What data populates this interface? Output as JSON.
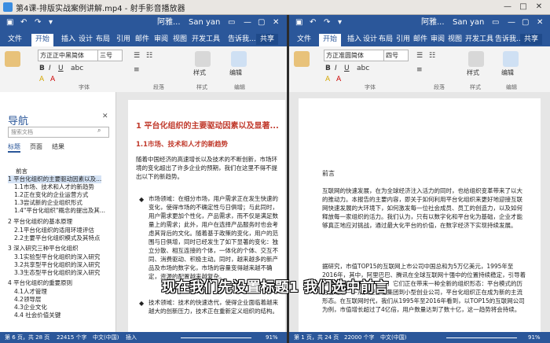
{
  "player": {
    "title": "第4课-排版实战案例讲解.mp4 - 射手影音播放器",
    "min_icon": "—",
    "max_icon": "□",
    "close_icon": "✕"
  },
  "left": {
    "qat_title": "阿雅...",
    "user": "San yan",
    "tabs": [
      "文件",
      "开始",
      "插入",
      "设计",
      "布局",
      "引用",
      "邮件",
      "审阅",
      "视图",
      "开发工具"
    ],
    "tell_me": "告诉我...",
    "share": "共享",
    "font_name": "方正正中黑简体",
    "font_size": "三号",
    "group_font": "字体",
    "group_para": "段落",
    "group_style": "样式",
    "group_edit": "编辑",
    "btn_style": "样式",
    "btn_edit": "编辑",
    "nav": {
      "title": "导航",
      "search_placeholder": "搜索文档",
      "tabs": [
        "标题",
        "页面",
        "结果"
      ],
      "items": [
        "前言",
        "1 平台化组织的主要驱动因素以及...",
        "1.1市场、技术和人才的新趋势",
        "1.2正在变化的企业运营方式",
        "1.3尝试新的企业组织形式",
        "1.4\"平台化组织\"概念的提出及其...",
        "2 平台化组织的基本原理",
        "2.1平台化组织的适用环境评估",
        "2.2主要平台化组织模式及其特点",
        "3 深入研究三种平台化组织",
        "3.1实验型平台化组织的深入研究",
        "3.2共享型平台化组织的深入研究",
        "3.3生态型平台化组织的深入研究",
        "4 平台化组织的重要原则",
        "4.1人才管理",
        "4.2领导层",
        "4.3企业文化",
        "4.4 社会价值关键"
      ]
    },
    "doc": {
      "h1": "1 平台化组织的主要驱动因素以及显著...",
      "h2": "1.1市场、技术和人才的新趋势",
      "intro": "随着中国经济的高速增长以及技术的不断创新，市场环境的变化超出了许多企业的预期，我们在这里不得不提出以下的新趋势。",
      "bullet1": "市场领域：在细分市场，用户需求正在发生快速的变化，使得市场的不确定性与日俱增；与此同时，用户需求更加个性化，产品需求，而不仅是满足数量上的需求；此外，用户在选择产品服务时也会考虑其背后的文化。随着基于政策的变化，用户的范围与日俱增，同时已经发生了如下显著的变化：独立分散、相互连接的个体，一体化的个体、交互不同、消费驱动、积极主动。同时，越来越多的新产品及市场的数字化，市场的容量变得越来越不确定，资源的配置越来越复杂。",
      "bullet2": "技术领域：技术的快速迭代，使得企业面临着越来越大的创新压力，技术正在重新定义组织的结构。",
      "page_status": "第 6 页，共 28 页",
      "words": "22415 个字",
      "lang": "中文(中国)",
      "mode": "插入",
      "zoom": "91%"
    }
  },
  "right": {
    "qat_title": "阿雅...",
    "user": "San yan",
    "tabs": [
      "文件",
      "开始",
      "插入",
      "设计",
      "布局",
      "引用",
      "邮件",
      "审阅",
      "视图",
      "开发工具"
    ],
    "tell_me": "告诉我...",
    "share": "共享",
    "font_name": "方正准圆简体",
    "font_size": "四号",
    "group_font": "字体",
    "group_para": "段落",
    "group_style": "样式",
    "group_edit": "编辑",
    "btn_style": "样式",
    "btn_edit": "编辑",
    "doc": {
      "heading": "前言",
      "para1": "互联网的快速发展，在为全球经济注入活力的同时，也给组织变革带来了以大的推动力。本报告的主要内容，即关于如何利用平台化组织来更好地迎接互联网快速发展的大环境下，如何激发每一位社会成员、员工的创造力，以及如何释放每一家组织的活力。我们认为，只有以数字化和平台化为基础，企业才能够真正地应对挑战，通过最大化平台的价值，在数字经济下实现持续发展。",
      "para2": "据研究，市值TOP15的互联网上市公司中国总和为5万亿美元，1995年至2016年，其中，阿里巴巴、腾讯在全球互联网十强中的位置持续稳定，引导着新时代的发展趋势。同时，它们正在带来一种全新的组织形态：平台模式的历史性崛起——从大型企业集团到小型创业公司，平台化组织正在成为新的主流形态。在互联网时代，我们从1995年至2016年看到，以TOP15的互联网公司为例，市值增长超过了4亿倍，用户数量达到了数十亿，这一趋势将会持续。",
      "page_status": "第 1 页，共 24 页",
      "words": "22000 个字",
      "lang": "中文(中国)",
      "zoom": "91%"
    }
  },
  "subtitle": "现在我们先设置标题1 我们选中前言"
}
